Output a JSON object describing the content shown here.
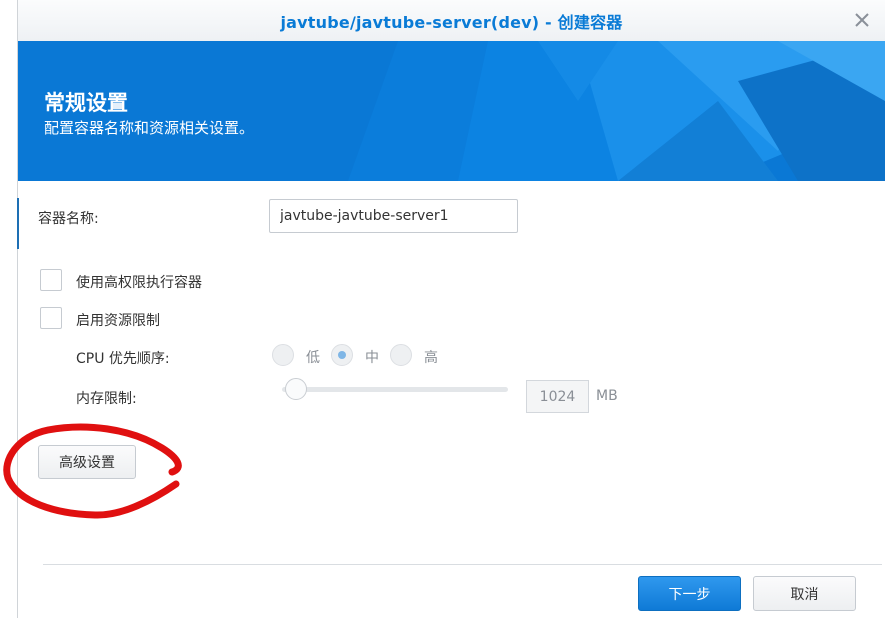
{
  "window": {
    "title": "javtube/javtube-server(dev) - 创建容器",
    "close_icon": "close-icon"
  },
  "banner": {
    "title": "常规设置",
    "subtitle": "配置容器名称和资源相关设置。",
    "color": "#0a78d5"
  },
  "form": {
    "container_name": {
      "label": "容器名称:",
      "value": "javtube-javtube-server1"
    },
    "privileged": {
      "label": "使用高权限执行容器",
      "checked": false
    },
    "resource_limit": {
      "label": "启用资源限制",
      "checked": false
    },
    "cpu_priority": {
      "label": "CPU 优先顺序:",
      "options": [
        "低",
        "中",
        "高"
      ],
      "selected": "中"
    },
    "memory_limit": {
      "label": "内存限制:",
      "value": "1024",
      "unit": "MB"
    }
  },
  "buttons": {
    "advanced": "高级设置",
    "next": "下一步",
    "cancel": "取消"
  },
  "colors": {
    "accent": "#0a7bd6",
    "primary_button": "#1a86e0",
    "annotation": "#e01010"
  }
}
